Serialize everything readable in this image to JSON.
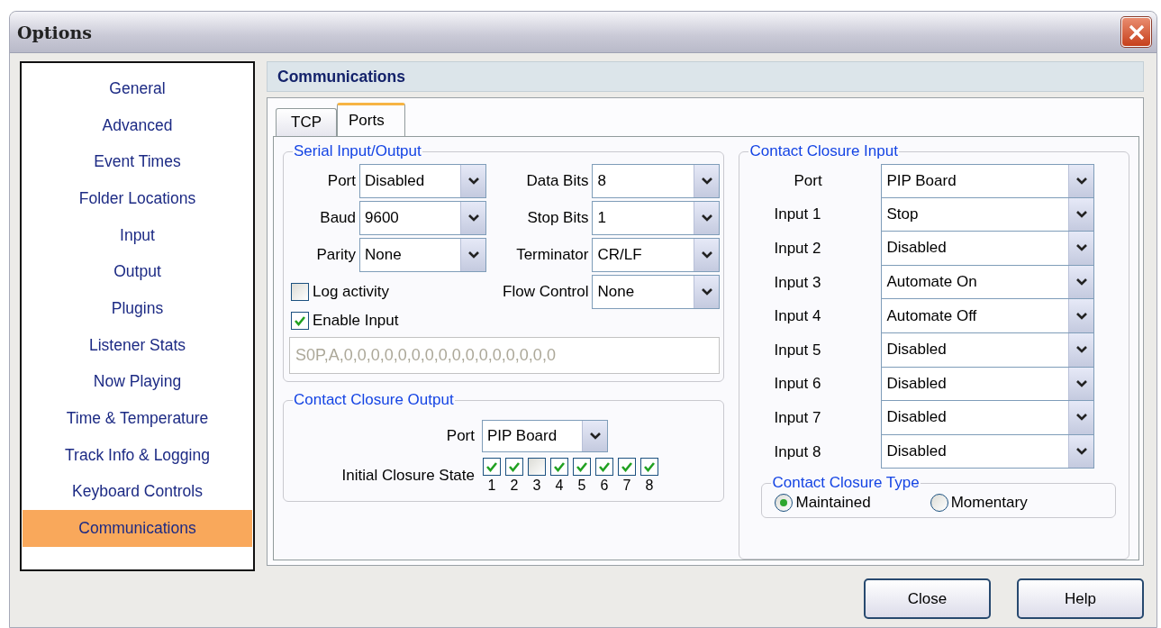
{
  "window": {
    "title": "Options"
  },
  "sidebar": {
    "items": [
      {
        "label": "General",
        "selected": false
      },
      {
        "label": "Advanced",
        "selected": false
      },
      {
        "label": "Event Times",
        "selected": false
      },
      {
        "label": "Folder Locations",
        "selected": false
      },
      {
        "label": "Input",
        "selected": false
      },
      {
        "label": "Output",
        "selected": false
      },
      {
        "label": "Plugins",
        "selected": false
      },
      {
        "label": "Listener Stats",
        "selected": false
      },
      {
        "label": "Now Playing",
        "selected": false
      },
      {
        "label": "Time & Temperature",
        "selected": false
      },
      {
        "label": "Track Info & Logging",
        "selected": false
      },
      {
        "label": "Keyboard Controls",
        "selected": false
      },
      {
        "label": "Communications",
        "selected": true
      }
    ]
  },
  "panel": {
    "title": "Communications"
  },
  "tabs": [
    {
      "label": "TCP",
      "selected": false
    },
    {
      "label": "Ports",
      "selected": true
    }
  ],
  "serial": {
    "title": "Serial Input/Output",
    "left_fields": [
      {
        "label": "Port",
        "value": "Disabled"
      },
      {
        "label": "Baud",
        "value": "9600"
      },
      {
        "label": "Parity",
        "value": "None"
      }
    ],
    "right_fields": [
      {
        "label": "Data Bits",
        "value": "8"
      },
      {
        "label": "Stop Bits",
        "value": "1"
      },
      {
        "label": "Terminator",
        "value": "CR/LF"
      },
      {
        "label": "Flow Control",
        "value": "None"
      }
    ],
    "checkboxes": [
      {
        "label": "Log activity",
        "checked": false
      },
      {
        "label": "Enable Input",
        "checked": true
      }
    ],
    "input_string": {
      "value": "S0P,A,0,0,0,0,0,0,0,0,0,0,0,0,0,0,0,0",
      "disabled": true
    }
  },
  "closure_output": {
    "title": "Contact Closure Output",
    "port": {
      "label": "Port",
      "value": "PIP Board"
    },
    "initial_state": {
      "label": "Initial Closure State",
      "boxes": [
        {
          "number": "1",
          "checked": true
        },
        {
          "number": "2",
          "checked": true
        },
        {
          "number": "3",
          "checked": false
        },
        {
          "number": "4",
          "checked": true
        },
        {
          "number": "5",
          "checked": true
        },
        {
          "number": "6",
          "checked": true
        },
        {
          "number": "7",
          "checked": true
        },
        {
          "number": "8",
          "checked": true
        }
      ]
    }
  },
  "closure_input": {
    "title": "Contact Closure Input",
    "fields": [
      {
        "label": "Port",
        "value": "PIP Board"
      },
      {
        "label": "Input 1",
        "value": "Stop"
      },
      {
        "label": "Input 2",
        "value": "Disabled"
      },
      {
        "label": "Input 3",
        "value": "Automate On"
      },
      {
        "label": "Input 4",
        "value": "Automate Off"
      },
      {
        "label": "Input 5",
        "value": "Disabled"
      },
      {
        "label": "Input 6",
        "value": "Disabled"
      },
      {
        "label": "Input 7",
        "value": "Disabled"
      },
      {
        "label": "Input 8",
        "value": "Disabled"
      }
    ],
    "type_group": {
      "title": "Contact Closure Type",
      "options": [
        {
          "label": "Maintained",
          "selected": true
        },
        {
          "label": "Momentary",
          "selected": false
        }
      ]
    }
  },
  "buttons": [
    "Close",
    "Help"
  ]
}
